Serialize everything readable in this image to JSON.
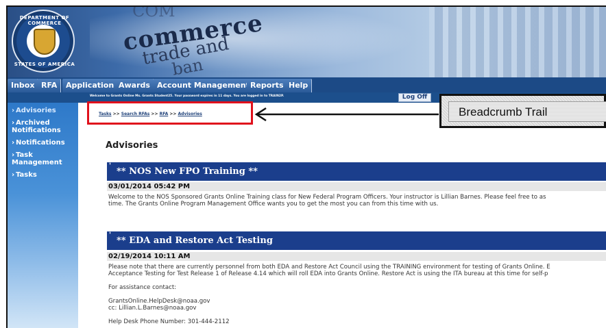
{
  "banner": {
    "seal_top_text": "DEPARTMENT OF COMMERCE",
    "seal_bottom_text": "STATES OF AMERICA",
    "words": [
      "COM",
      "commerce",
      "trade and",
      "ban"
    ]
  },
  "nav": {
    "tabs": [
      "Inbox",
      "RFA",
      "Application",
      "Awards",
      "Account Management",
      "Reports",
      "Help"
    ]
  },
  "status_bar": {
    "message": "Welcome to Grants Online Ms. Grants Student25. Your password expires in 11 days. You are logged in to TRAIN2P.",
    "logoff_label": "Log Off"
  },
  "sidebar": {
    "items": [
      {
        "label": "Advisories"
      },
      {
        "label": "Archived Notifications"
      },
      {
        "label": "Notifications"
      },
      {
        "label": "Task Management"
      },
      {
        "label": "Tasks"
      }
    ]
  },
  "breadcrumb": {
    "items": [
      "Tasks",
      "Search RFAs",
      "RFA",
      "Advisories"
    ],
    "separator": ">>"
  },
  "page": {
    "title": "Advisories"
  },
  "advisories": [
    {
      "title": "** NOS New FPO Training **",
      "date": "03/01/2014 05:42 PM",
      "body": [
        "Welcome to the NOS Sponsored Grants Online Training class for New Federal Program Officers.  Your instructor is Lillian Barnes.  Please feel free to as",
        "time.  The Grants Online Program Management Office wants you to get the most you can from this time with us."
      ]
    },
    {
      "title": "** EDA and Restore Act Testing",
      "date": "02/19/2014 10:11 AM",
      "body": [
        "Please note that there are currently personnel from both EDA and Restore Act Council using the TRAINING environment for testing of Grants Online.  E",
        "Acceptance Testing for Test Release 1 of Release 4.14 which will roll EDA into Grants Online.  Restore Act is using the ITA bureau at this time for self-p",
        "",
        "For assistance contact:",
        "",
        "GrantsOnline.HelpDesk@noaa.gov",
        "cc: Lillian.L.Barnes@noaa.gov",
        "",
        "Help Desk Phone Number: 301-444-2112"
      ]
    }
  ],
  "annotation": {
    "callout_label": "Breadcrumb Trail",
    "highlight_color": "#e0101c"
  }
}
